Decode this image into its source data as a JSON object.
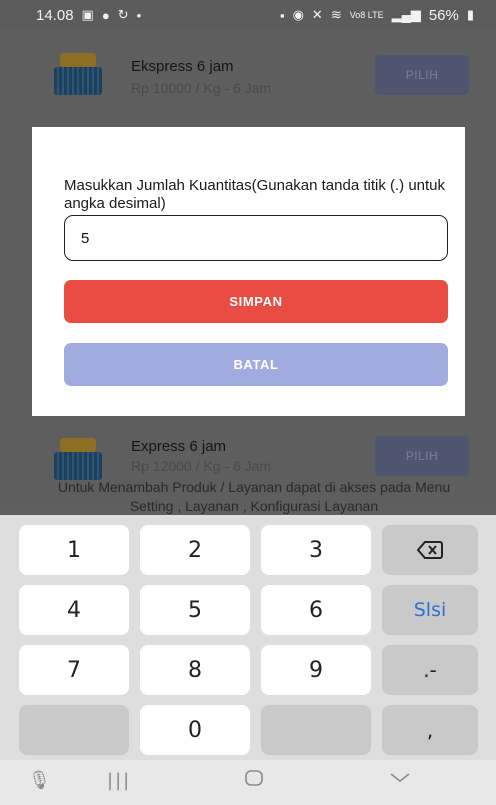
{
  "status_bar": {
    "time": "14.08",
    "battery": "56%",
    "signal": "Vo8 LTE"
  },
  "services": [
    {
      "name": "Ekspress 6 jam",
      "price": "Rp 10000 / Kg - 6 Jam",
      "button": "PILIH"
    },
    {
      "name": "Express 6 jam",
      "price": "Rp 12000 / Kg - 6 Jam",
      "button": "PILIH"
    }
  ],
  "info_text": "Untuk Menambah Produk / Layanan dapat di akses pada Menu Setting , Layanan , Konfigurasi Layanan",
  "dialog": {
    "label": "Masukkan Jumlah Kuantitas(Gunakan tanda titik (.) untuk angka desimal)",
    "quantity_value": "5",
    "save_label": "SIMPAN",
    "cancel_label": "BATAL"
  },
  "keyboard": {
    "keys": [
      "1",
      "2",
      "3",
      "4",
      "5",
      "6",
      "7",
      "8",
      "9",
      "0"
    ],
    "fill_label": "Slsi",
    "dot_dash": ".-",
    "comma": ","
  },
  "colors": {
    "save_button": "#e84c42",
    "cancel_button": "#a2abe0",
    "fill_key_text": "#2f6fd6"
  }
}
